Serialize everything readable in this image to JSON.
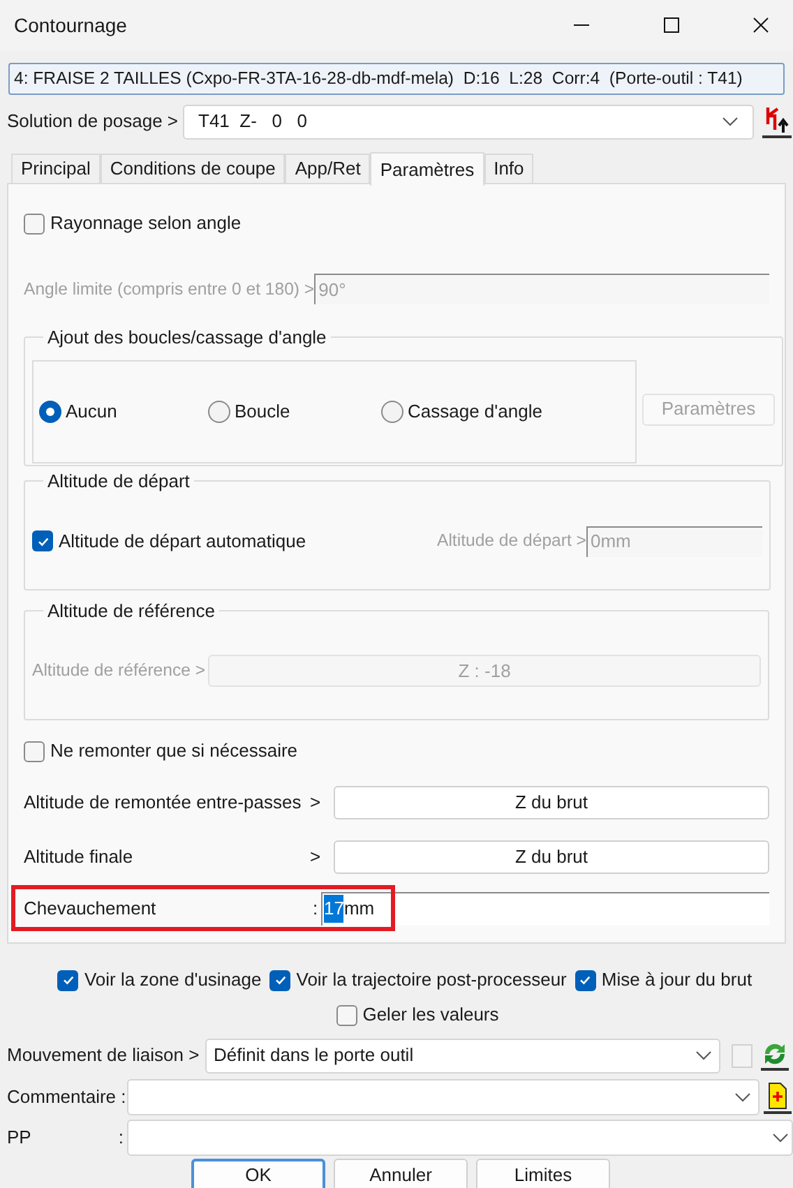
{
  "window": {
    "title": "Contournage"
  },
  "tool": {
    "value": "4: FRAISE 2 TAILLES (Cxpo-FR-3TA-16-28-db-mdf-mela)  D:16  L:28  Corr:4  (Porte-outil : T41)"
  },
  "solution": {
    "label": "Solution de posage >",
    "value": "T41  Z-   0   0"
  },
  "tabs": [
    {
      "label": "Principal",
      "selected": false
    },
    {
      "label": "Conditions de coupe",
      "selected": false
    },
    {
      "label": "App/Ret",
      "selected": false
    },
    {
      "label": "Paramètres",
      "selected": true
    },
    {
      "label": "Info",
      "selected": false
    }
  ],
  "rayonnage": {
    "label": "Rayonnage selon angle",
    "checked": false
  },
  "angle_limite": {
    "label": "Angle limite (compris entre 0 et 180) >",
    "value": "90°",
    "disabled": true
  },
  "boucles": {
    "title": "Ajout des boucles/cassage d'angle",
    "options": [
      {
        "label": "Aucun",
        "selected": true
      },
      {
        "label": "Boucle",
        "selected": false
      },
      {
        "label": "Cassage d'angle",
        "selected": false
      }
    ],
    "button": {
      "label": "Paramètres",
      "disabled": true
    }
  },
  "depart": {
    "title": "Altitude de départ",
    "auto": {
      "label": "Altitude de départ automatique",
      "checked": true
    },
    "field": {
      "label": "Altitude de départ >",
      "value": "0mm",
      "disabled": true
    }
  },
  "reference": {
    "title": "Altitude de référence",
    "label": "Altitude de référence >",
    "button": "Z : -18",
    "disabled": true
  },
  "ne_remonter": {
    "label": "Ne remonter que si nécessaire",
    "checked": false
  },
  "rows": [
    {
      "label": "Altitude de remontée entre-passes",
      "sep": ">",
      "button": "Z du brut"
    },
    {
      "label": "Altitude finale",
      "sep": ">",
      "button": "Z du brut"
    }
  ],
  "chevauchement": {
    "label": "Chevauchement",
    "sep": ":",
    "selected_text": "17",
    "text": "mm",
    "highlighted": true
  },
  "options": [
    {
      "label": "Voir la zone d'usinage",
      "checked": true
    },
    {
      "label": "Voir la trajectoire post-processeur",
      "checked": true
    },
    {
      "label": "Mise à jour du brut",
      "checked": true
    }
  ],
  "geler": {
    "label": "Geler les valeurs",
    "checked": false
  },
  "mouvement": {
    "label": "Mouvement de liaison >",
    "value": "Définit dans le porte outil",
    "checked": false
  },
  "commentaire": {
    "label": "Commentaire :"
  },
  "pp": {
    "label": "PP",
    "sep": ":"
  },
  "buttons": [
    {
      "label": "OK",
      "default": true
    },
    {
      "label": "Annuler",
      "default": false
    },
    {
      "label": "Limites",
      "default": false
    }
  ]
}
